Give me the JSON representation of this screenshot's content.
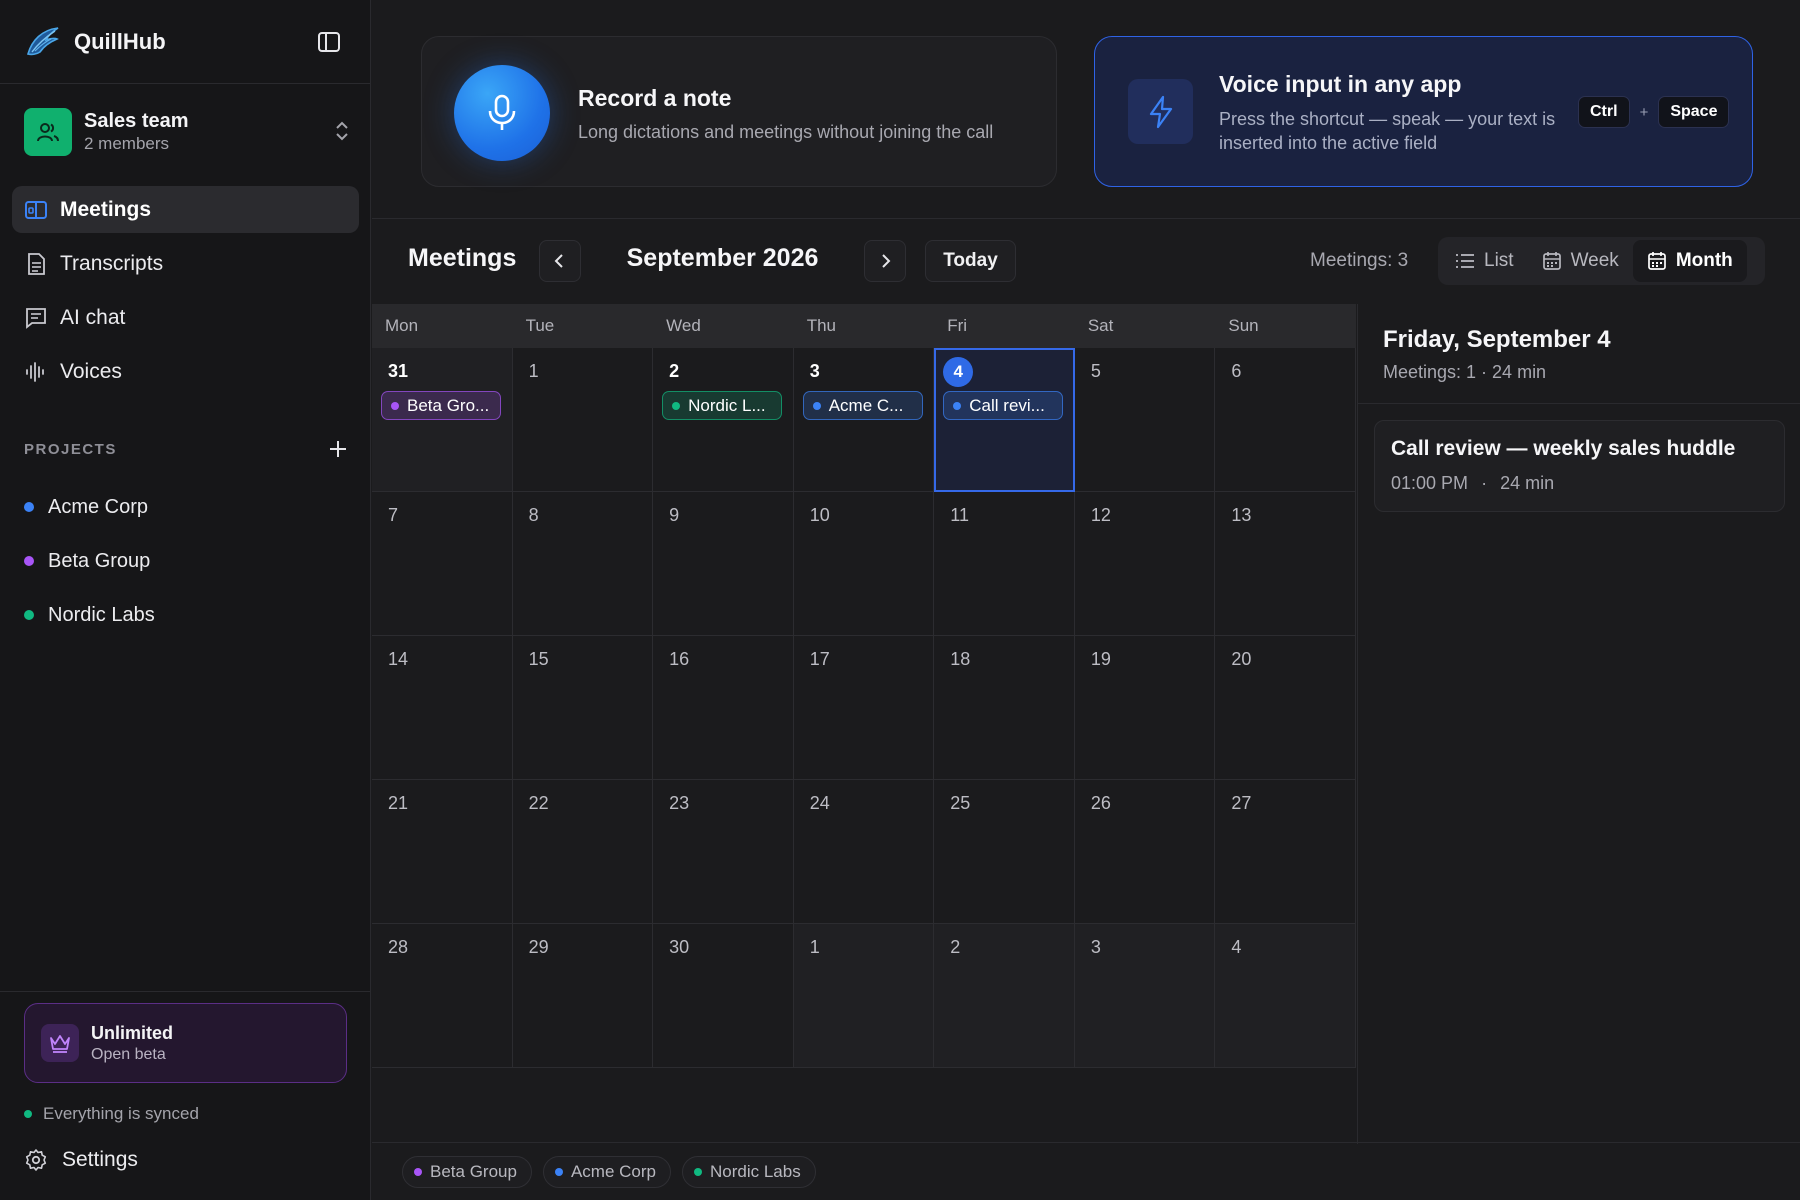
{
  "app": {
    "name": "QuillHub"
  },
  "colors": {
    "accent": "#2f6ae6",
    "beta": "#a855f7",
    "acme": "#3b82f6",
    "nordic": "#10b981",
    "team": "#10b06e"
  },
  "team": {
    "name": "Sales team",
    "members": "2 members"
  },
  "nav": [
    {
      "label": "Meetings",
      "icon": "meetings-icon",
      "active": true
    },
    {
      "label": "Transcripts",
      "icon": "transcripts-icon"
    },
    {
      "label": "AI chat",
      "icon": "ai-chat-icon"
    },
    {
      "label": "Voices",
      "icon": "voices-icon"
    }
  ],
  "projects": {
    "title": "PROJECTS",
    "items": [
      {
        "label": "Acme Corp",
        "color": "#3b82f6"
      },
      {
        "label": "Beta Group",
        "color": "#a855f7"
      },
      {
        "label": "Nordic Labs",
        "color": "#10b981"
      }
    ]
  },
  "plan": {
    "title": "Unlimited",
    "subtitle": "Open beta"
  },
  "sync": {
    "label": "Everything is synced"
  },
  "settings": {
    "label": "Settings"
  },
  "record_card": {
    "title": "Record a note",
    "subtitle": "Long dictations and meetings without joining the call"
  },
  "voice_card": {
    "title": "Voice input in any app",
    "subtitle": "Press the shortcut — speak — your text is inserted into the active field",
    "key1": "Ctrl",
    "plus": "+",
    "key2": "Space"
  },
  "toolbar": {
    "title": "Meetings",
    "month": "September 2026",
    "today": "Today",
    "count": "Meetings: 3",
    "views": [
      {
        "label": "List",
        "icon": "list-icon"
      },
      {
        "label": "Week",
        "icon": "week-calendar-icon"
      },
      {
        "label": "Month",
        "icon": "month-calendar-icon",
        "active": true
      }
    ]
  },
  "calendar": {
    "weekdays": [
      "Mon",
      "Tue",
      "Wed",
      "Thu",
      "Fri",
      "Sat",
      "Sun"
    ],
    "days": [
      {
        "n": "31",
        "muted": true,
        "strong": true,
        "event": {
          "label": "Beta Gro...",
          "color": "#a855f7"
        }
      },
      {
        "n": "1"
      },
      {
        "n": "2",
        "strong": true,
        "event": {
          "label": "Nordic L...",
          "color": "#10b981"
        }
      },
      {
        "n": "3",
        "strong": true,
        "event": {
          "label": "Acme C...",
          "color": "#3b82f6"
        }
      },
      {
        "n": "4",
        "today": true,
        "selected": true,
        "event": {
          "label": "Call revi...",
          "color": "#3b82f6"
        }
      },
      {
        "n": "5"
      },
      {
        "n": "6"
      },
      {
        "n": "7"
      },
      {
        "n": "8"
      },
      {
        "n": "9"
      },
      {
        "n": "10"
      },
      {
        "n": "11"
      },
      {
        "n": "12"
      },
      {
        "n": "13"
      },
      {
        "n": "14"
      },
      {
        "n": "15"
      },
      {
        "n": "16"
      },
      {
        "n": "17"
      },
      {
        "n": "18"
      },
      {
        "n": "19"
      },
      {
        "n": "20"
      },
      {
        "n": "21"
      },
      {
        "n": "22"
      },
      {
        "n": "23"
      },
      {
        "n": "24"
      },
      {
        "n": "25"
      },
      {
        "n": "26"
      },
      {
        "n": "27"
      },
      {
        "n": "28"
      },
      {
        "n": "29"
      },
      {
        "n": "30"
      },
      {
        "n": "1",
        "muted": true
      },
      {
        "n": "2",
        "muted": true
      },
      {
        "n": "3",
        "muted": true
      },
      {
        "n": "4",
        "muted": true
      }
    ]
  },
  "day_panel": {
    "title": "Friday, September 4",
    "subtitle": "Meetings: 1 · 24 min",
    "meetings": [
      {
        "title": "Call review — weekly sales huddle",
        "time": "01:00 PM",
        "sep": "·",
        "duration": "24 min"
      }
    ]
  },
  "legend": [
    {
      "label": "Beta Group",
      "color": "#a855f7"
    },
    {
      "label": "Acme Corp",
      "color": "#3b82f6"
    },
    {
      "label": "Nordic Labs",
      "color": "#10b981"
    }
  ]
}
